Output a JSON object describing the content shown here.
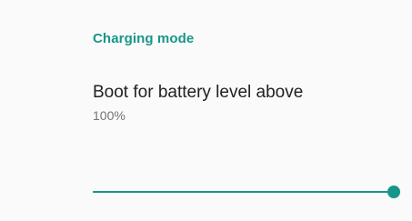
{
  "colors": {
    "accent": "#17968a",
    "track": "#17968a",
    "background": "#fafafa",
    "title_text": "#212121",
    "summary_text": "#757575"
  },
  "settings": {
    "section_title": "Charging mode",
    "preference": {
      "title": "Boot for battery level above",
      "summary": "100%"
    },
    "slider": {
      "min": 0,
      "max": 100,
      "value": 100
    }
  }
}
